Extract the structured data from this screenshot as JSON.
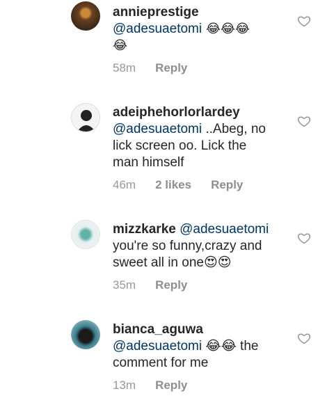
{
  "comments": [
    {
      "username": "annieprestige",
      "mention": "@adesuaetomi",
      "body_after": " 😂😂😂",
      "body_line2": "😂",
      "time": "58m",
      "likes": "",
      "reply": "Reply"
    },
    {
      "username": "adeiphehorlorlardey",
      "mention": "@adesuaetomi",
      "body_after": " ..Abeg, no",
      "body_line2": "lick screen oo. Lick the",
      "body_line3": "man himself",
      "time": "46m",
      "likes": "2 likes",
      "reply": "Reply"
    },
    {
      "username": "mizzkarke",
      "mention": "@adesuaetomi",
      "body_line2": "you're so funny,crazy and",
      "body_line3": "sweet all in one😍😍",
      "time": "35m",
      "likes": "",
      "reply": "Reply"
    },
    {
      "username": "bianca_aguwa",
      "mention": "@adesuaetomi",
      "body_after": " 😂😂 the",
      "body_line2": "comment for me",
      "time": "13m",
      "likes": "",
      "reply": "Reply"
    }
  ],
  "icons": {
    "like": "heart-outline-icon"
  },
  "colors": {
    "mention": "#003569",
    "meta": "#999999",
    "text": "#262626"
  }
}
